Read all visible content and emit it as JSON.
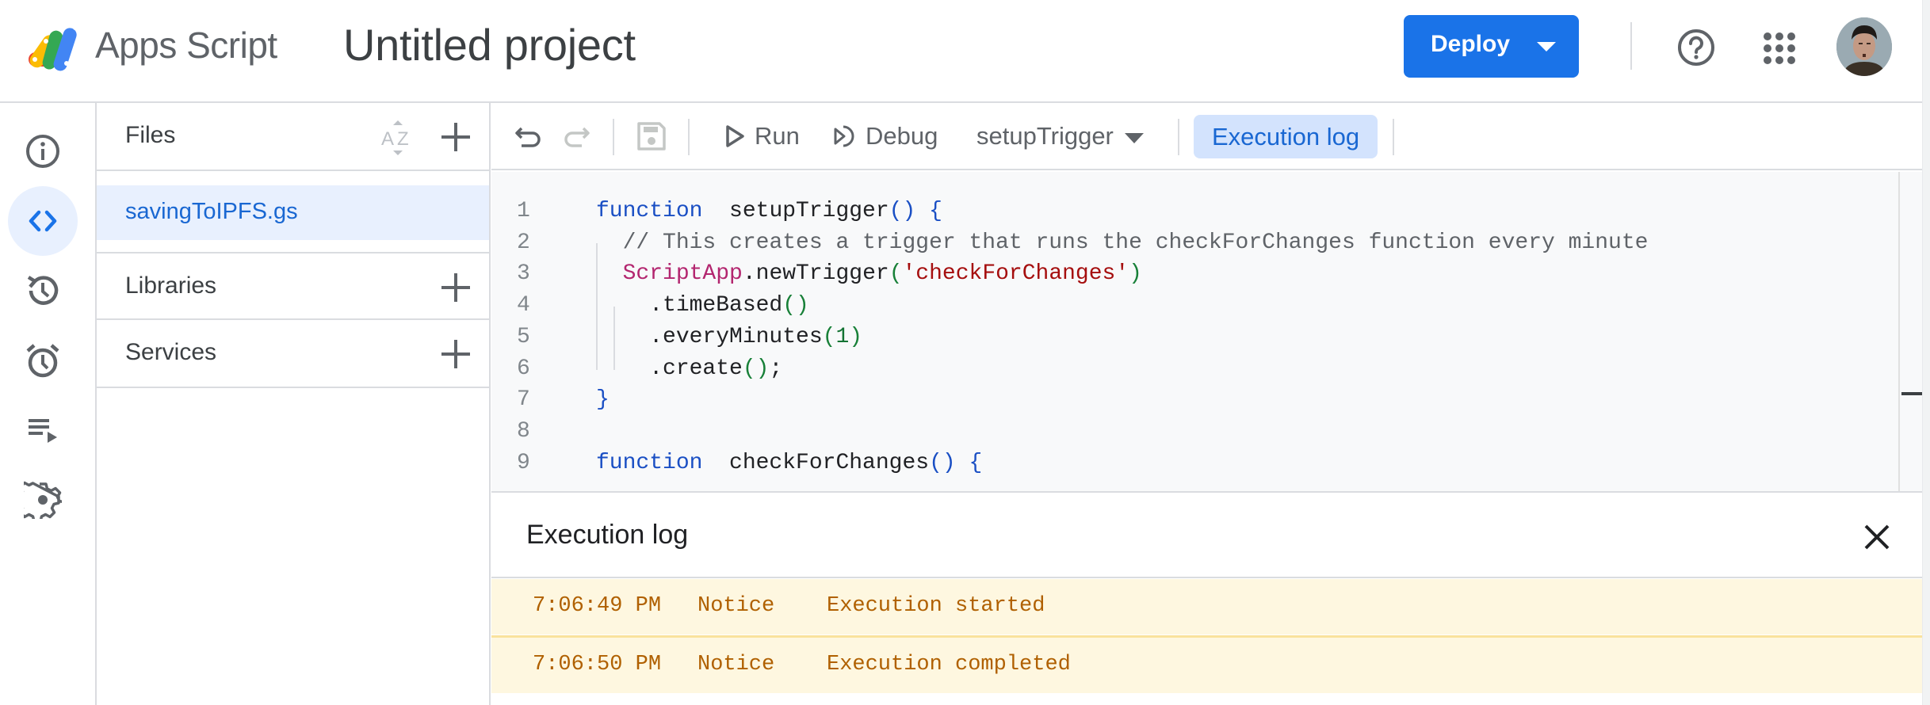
{
  "header": {
    "app_name": "Apps Script",
    "project_title": "Untitled project",
    "deploy_label": "Deploy",
    "icons": [
      "apps-script-logo",
      "help-icon",
      "google-apps-grid-icon",
      "avatar"
    ]
  },
  "rail": {
    "items": [
      {
        "name": "overview",
        "icon": "info-icon",
        "active": false
      },
      {
        "name": "editor",
        "icon": "code-icon",
        "active": true
      },
      {
        "name": "project-history",
        "icon": "history-icon",
        "active": false
      },
      {
        "name": "triggers",
        "icon": "alarm-clock-icon",
        "active": false
      },
      {
        "name": "executions",
        "icon": "playlist-play-icon",
        "active": false
      },
      {
        "name": "project-settings",
        "icon": "gear-icon",
        "active": false
      }
    ]
  },
  "files_panel": {
    "files_label": "Files",
    "files": [
      {
        "name": "savingToIPFS.gs",
        "selected": true
      }
    ],
    "libraries_label": "Libraries",
    "services_label": "Services"
  },
  "toolbar": {
    "run_label": "Run",
    "debug_label": "Debug",
    "selected_function": "setupTrigger",
    "execution_log_label": "Execution log",
    "execution_log_active": true
  },
  "editor": {
    "lines": [
      {
        "n": "1",
        "tokens": [
          [
            "kw",
            "function"
          ],
          [
            "",
            "  "
          ],
          [
            "",
            "setupTrigger"
          ],
          [
            "br-blue",
            "()"
          ],
          [
            "",
            ""
          ],
          [
            "br-blue",
            " {"
          ]
        ]
      },
      {
        "n": "2",
        "tokens": [
          [
            "",
            "  "
          ],
          [
            "cmt",
            "// This creates a trigger that runs the checkForChanges function every minute"
          ]
        ]
      },
      {
        "n": "3",
        "tokens": [
          [
            "",
            "  "
          ],
          [
            "cls",
            "ScriptApp"
          ],
          [
            "",
            ".newTrigger"
          ],
          [
            "br-green",
            "("
          ],
          [
            "str",
            "'checkForChanges'"
          ],
          [
            "br-green",
            ")"
          ]
        ]
      },
      {
        "n": "4",
        "tokens": [
          [
            "",
            "    .timeBased"
          ],
          [
            "br-green",
            "()"
          ]
        ]
      },
      {
        "n": "5",
        "tokens": [
          [
            "",
            "    .everyMinutes"
          ],
          [
            "br-green",
            "("
          ],
          [
            "num",
            "1"
          ],
          [
            "br-green",
            ")"
          ]
        ]
      },
      {
        "n": "6",
        "tokens": [
          [
            "",
            "    .create"
          ],
          [
            "br-green",
            "()"
          ],
          [
            "",
            ";"
          ]
        ]
      },
      {
        "n": "7",
        "tokens": [
          [
            "br-blue",
            "}"
          ]
        ]
      },
      {
        "n": "8",
        "tokens": []
      },
      {
        "n": "9",
        "tokens": [
          [
            "kw",
            "function"
          ],
          [
            "",
            ""
          ],
          [
            "",
            "  checkForChanges"
          ],
          [
            "br-blue",
            "()"
          ],
          [
            "br-blue",
            " {"
          ]
        ]
      }
    ]
  },
  "execution_log": {
    "title": "Execution log",
    "entries": [
      {
        "time": "7:06:49 PM",
        "level": "Notice",
        "message": "Execution started"
      },
      {
        "time": "7:06:50 PM",
        "level": "Notice",
        "message": "Execution completed"
      }
    ]
  },
  "colors": {
    "accent": "#1a73e8",
    "selected_bg": "#e8f0fe",
    "log_row_bg": "#fef7e0",
    "log_text": "#b06000"
  }
}
